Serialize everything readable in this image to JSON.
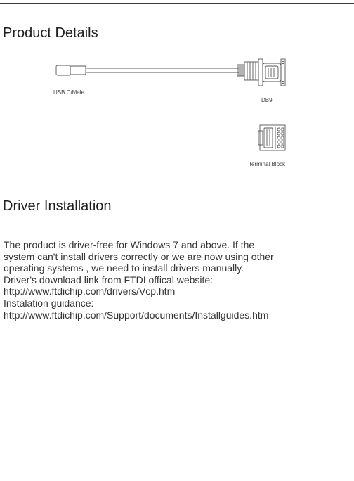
{
  "product_details": {
    "title": "Product Details",
    "labels": {
      "usb": "USB C/Male",
      "db9": "DB9",
      "terminal_block": "Terminal Block"
    }
  },
  "driver_installation": {
    "title": "Driver Installation",
    "lines": [
      "The product is driver-free for Windows 7 and above. If the",
      "system can't install drivers correctly or we are now using other",
      "operating systems , we need to install drivers manually.",
      "Driver's download link from FTDI offical website:",
      "http://www.ftdichip.com/drivers/Vcp.htm",
      "Instalation guidance:",
      "http://www.ftdichip.com/Support/documents/Installguides.htm"
    ]
  }
}
